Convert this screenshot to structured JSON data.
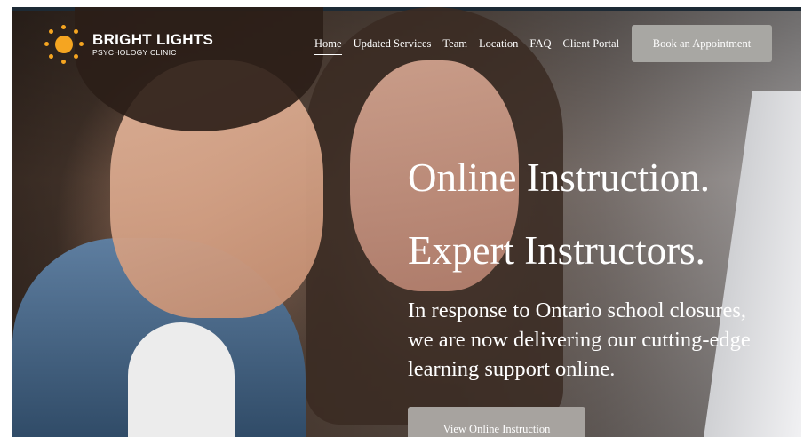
{
  "brand": {
    "name": "BRIGHT LIGHTS",
    "subtitle": "PSYCHOLOGY CLINIC",
    "logo_icon": "sun-icon",
    "accent_color": "#f5a521"
  },
  "nav": {
    "items": [
      {
        "label": "Home",
        "active": true
      },
      {
        "label": "Updated Services",
        "active": false
      },
      {
        "label": "Team",
        "active": false
      },
      {
        "label": "Location",
        "active": false
      },
      {
        "label": "FAQ",
        "active": false
      },
      {
        "label": "Client Portal",
        "active": false
      }
    ],
    "cta_label": "Book an Appointment"
  },
  "hero": {
    "headline_1": "Online Instruction.",
    "headline_2": "Expert Instructors.",
    "body": "In response to Ontario school closures, we are now delivering our cutting-edge learning support online.",
    "cta_label": "View Online Instruction"
  }
}
